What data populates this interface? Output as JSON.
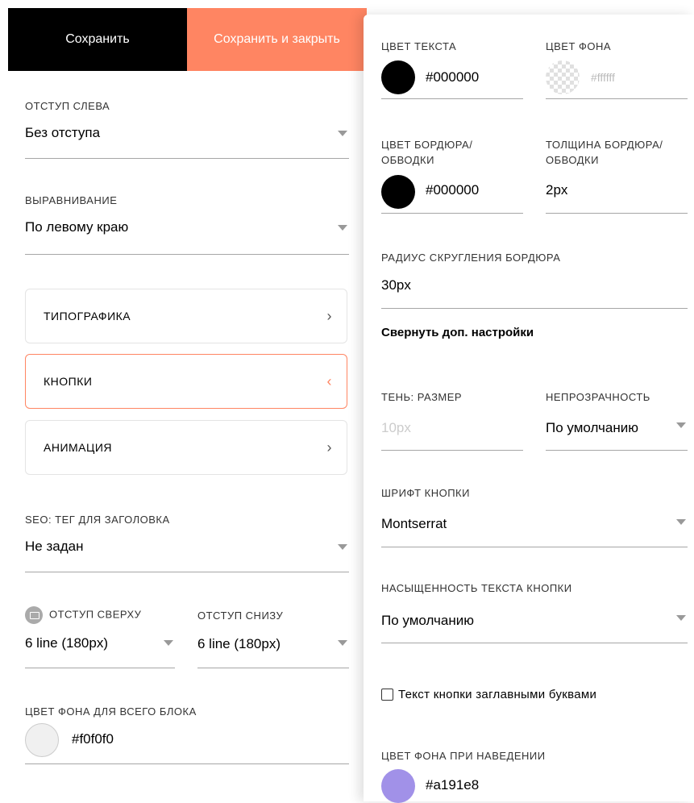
{
  "toolbar": {
    "save_label": "Сохранить",
    "save_close_label": "Сохранить и закрыть"
  },
  "left": {
    "indent_left": {
      "label": "ОТСТУП СЛЕВА",
      "value": "Без отступа"
    },
    "alignment": {
      "label": "ВЫРАВНИВАНИЕ",
      "value": "По левому краю"
    },
    "cards": [
      {
        "label": "ТИПОГРАФИКА",
        "chevron": "›"
      },
      {
        "label": "КНОПКИ",
        "chevron": "‹"
      },
      {
        "label": "АНИМАЦИЯ",
        "chevron": "›"
      }
    ],
    "seo": {
      "label": "SEO: ТЕГ ДЛЯ ЗАГОЛОВКА",
      "value": "Не задан"
    },
    "padding_top": {
      "label": "ОТСТУП СВЕРХУ",
      "value": "6 line (180px)"
    },
    "padding_bottom": {
      "label": "ОТСТУП СНИЗУ",
      "value": "6 line (180px)"
    },
    "block_bg": {
      "label": "ЦВЕТ ФОНА ДЛЯ ВСЕГО БЛОКА",
      "value": "#f0f0f0",
      "color": "#f0f0f0"
    }
  },
  "right": {
    "text_color": {
      "label": "ЦВЕТ ТЕКСТА",
      "value": "#000000",
      "color": "#000000"
    },
    "bg_color": {
      "label": "ЦВЕТ ФОНА",
      "value": "#ffffff"
    },
    "border_color": {
      "label": "ЦВЕТ БОРДЮРА/ ОБВОДКИ",
      "value": "#000000",
      "color": "#000000"
    },
    "border_width": {
      "label": "ТОЛЩИНА БОРДЮРА/ ОБВОДКИ",
      "value": "2px"
    },
    "border_radius": {
      "label": "РАДИУС СКРУГЛЕНИЯ БОРДЮРА",
      "value": "30px"
    },
    "collapse_link": "Свернуть доп. настройки",
    "shadow_size": {
      "label": "ТЕНЬ: РАЗМЕР",
      "placeholder": "10px"
    },
    "opacity": {
      "label": "НЕПРОЗРАЧНОСТЬ",
      "value": "По умолчанию"
    },
    "button_font": {
      "label": "ШРИФТ КНОПКИ",
      "value": "Montserrat"
    },
    "text_weight": {
      "label": "НАСЫЩЕННОСТЬ ТЕКСТА КНОПКИ",
      "value": "По умолчанию"
    },
    "uppercase_checkbox": {
      "label": "Текст кнопки заглавными буквами",
      "checked": false
    },
    "hover_bg": {
      "label": "ЦВЕТ ФОНА ПРИ НАВЕДЕНИИ",
      "value": "#a191e8",
      "color": "#a191e8"
    }
  },
  "colors": {
    "accent": "#ff8562",
    "dark": "#000000"
  },
  "icons": {
    "dropdown": "caret-down-icon",
    "device": "monitor-icon"
  }
}
